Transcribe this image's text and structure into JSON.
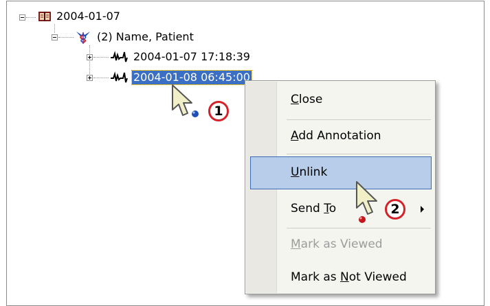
{
  "tree": {
    "root": {
      "label": "2004-01-07",
      "icon": "study-book-icon",
      "expanded": true
    },
    "patient": {
      "label": "(2) Name, Patient",
      "icon": "caduceus-icon",
      "expanded": true
    },
    "recordings": [
      {
        "label": "2004-01-07 17:18:39",
        "icon": "waveform-icon",
        "selected": false
      },
      {
        "label": "2004-01-08 06:45:00",
        "icon": "waveform-icon",
        "selected": true
      }
    ]
  },
  "context_menu": {
    "items": [
      {
        "label": "Close",
        "mnemonic": "C",
        "enabled": true,
        "hot": false
      },
      {
        "label": "Add Annotation",
        "mnemonic": "A",
        "enabled": true,
        "hot": false
      },
      {
        "label": "Unlink",
        "mnemonic": "U",
        "enabled": true,
        "hot": true
      },
      {
        "label": "Send To",
        "mnemonic": "T",
        "enabled": true,
        "hot": false,
        "submenu": true
      },
      {
        "label": "Mark as Viewed",
        "mnemonic": "M",
        "enabled": false,
        "hot": false
      },
      {
        "label": "Mark as Not Viewed",
        "mnemonic": "N",
        "enabled": true,
        "hot": false
      }
    ]
  },
  "callouts": [
    {
      "number": "1",
      "marker_color": "#1f4fb5"
    },
    {
      "number": "2",
      "marker_color": "#c4161c"
    }
  ],
  "colors": {
    "selection": "#3a6fc4",
    "menu_hot": "#b8cde9",
    "callout_ring": "#d3222a"
  }
}
